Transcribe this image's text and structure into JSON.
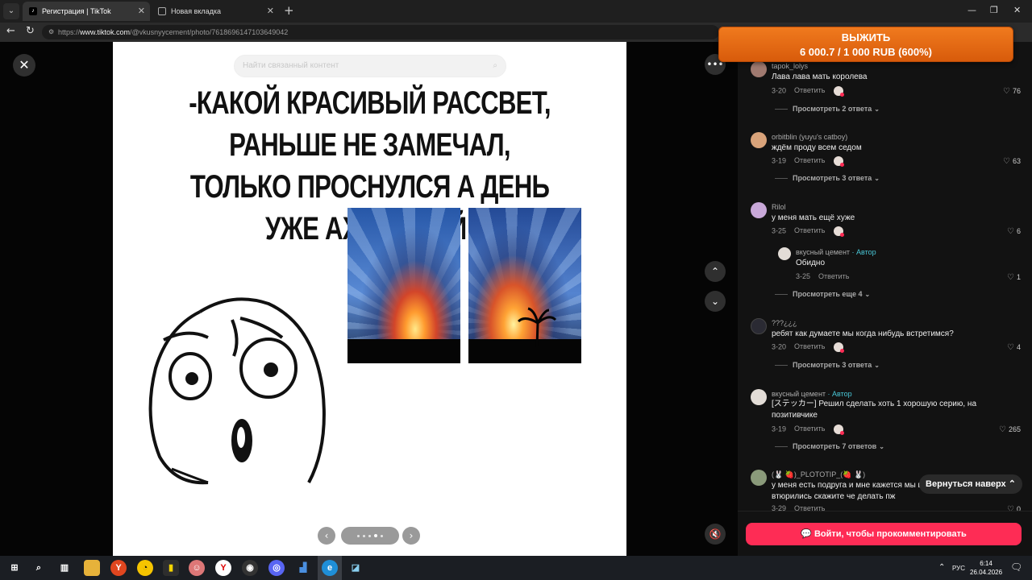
{
  "browser": {
    "tabs": [
      {
        "title": "Регистрация | TikTok",
        "active": true
      },
      {
        "title": "Новая вкладка",
        "active": false
      }
    ],
    "url_prefix": "https://",
    "url_host": "www.tiktok.com",
    "url_path": "/@vkusnyycement/photo/7618696147103649042"
  },
  "promo": {
    "line1": "ВЫЖИТЬ",
    "line2": "6 000.7 / 1 000 RUB (600%)"
  },
  "viewer": {
    "search_placeholder": "Найти связанный контент",
    "meme_text": "-КАКОЙ КРАСИВЫЙ РАССВЕТ, РАНЬШЕ НЕ ЗАМЕЧАЛ, ТОЛЬКО ПРОСНУЛСЯ А ДЕНЬ УЖЕ АХУЕННЫЙ!",
    "carousel": {
      "total": 5,
      "current": 4
    }
  },
  "comments": [
    {
      "user": "tapok_lolys",
      "text": "Лава лава мать королева",
      "date": "3-20",
      "reply": "Ответить",
      "likes": "76",
      "more": "Просмотреть 2 ответа"
    },
    {
      "user": "orbitblin (yuyu's catboy)",
      "text": "ждём проду всем седом",
      "date": "3-19",
      "reply": "Ответить",
      "likes": "63",
      "more": "Просмотреть 3 ответа"
    },
    {
      "user": "Rilol",
      "text": "у меня мать ещё хуже",
      "date": "3-25",
      "reply": "Ответить",
      "likes": "6",
      "more": ""
    },
    {
      "user": "вкусный цемент",
      "author": "· Автор",
      "text": "Обидно",
      "date": "3-25",
      "reply": "Ответить",
      "likes": "1",
      "more": "Просмотреть еще 4"
    },
    {
      "user": "???¿¿¿",
      "text": "ребят как думаете мы когда нибудь встретимся?",
      "date": "3-20",
      "reply": "Ответить",
      "likes": "4",
      "more": "Просмотреть 3 ответа"
    },
    {
      "user": "вкусный цемент",
      "author": "· Автор",
      "text": "[ステッカー] Решил сделать хоть 1 хорошую серию, на позитивчике",
      "date": "3-19",
      "reply": "Ответить",
      "likes": "265",
      "more": "Просмотреть 7 ответов"
    },
    {
      "user": "(🐰 🍓)_PLOTOTIP_(🍓 🐰)",
      "text": "у меня есть подруга и мне кажется мы в втюрились скажите че делать пж",
      "date": "3-29",
      "reply": "Ответить",
      "likes": "0",
      "more": ""
    }
  ],
  "back_to_top": "Вернуться наверх",
  "login_comment": "Войти, чтобы прокомментировать",
  "taskbar": {
    "lang": "РУС",
    "time": "6:14",
    "date": "26.04.2026"
  },
  "colors": {
    "accent": "#fe2c55",
    "author": "#49c6d6",
    "promo": "#e8680f"
  }
}
